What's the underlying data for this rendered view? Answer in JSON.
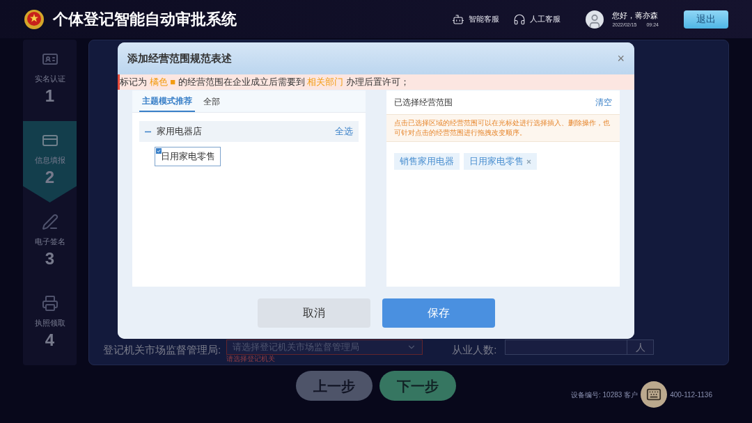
{
  "header": {
    "title": "个体登记智能自动审批系统",
    "services": [
      {
        "kind": "bot",
        "label": "智能客服"
      },
      {
        "kind": "human",
        "label": "人工客服"
      }
    ],
    "user": {
      "greeting": "您好，蒋亦森",
      "date": "2022/02/15",
      "time": "09:24"
    },
    "logout": "退出"
  },
  "steps": [
    {
      "kind": "id",
      "label": "实名认证",
      "number": "1",
      "selected": false
    },
    {
      "kind": "form",
      "label": "信息填报",
      "number": "2",
      "selected": true
    },
    {
      "kind": "sign",
      "label": "电子签名",
      "number": "3",
      "selected": false
    },
    {
      "kind": "license",
      "label": "执照领取",
      "number": "4",
      "selected": false
    }
  ],
  "form": {
    "authority_label": "登记机关市场监督管理局:",
    "authority_placeholder": "请选择登记机关市场监督管理局",
    "authority_error": "请选择登记机关",
    "staff_label": "从业人数:",
    "staff_unit": "人"
  },
  "nav": {
    "prev": "上一步",
    "next": "下一步"
  },
  "footer": {
    "device": "设备编号: 10283 客户",
    "phone": "400-112-1136"
  },
  "dialog": {
    "title": "添加经营范围规范表述",
    "close": "×",
    "notice": "标记为 **橘色 ■** 的经营范围在企业成立后需要到 **相关部门** 办理后置许可；",
    "tabs": [
      {
        "label": "主题模式推荐",
        "selected": true
      },
      {
        "label": "全部",
        "selected": false
      }
    ],
    "groups": [
      {
        "label": "家用电器店",
        "expanded": true,
        "action": "全选",
        "children": [
          {
            "label": "日用家电零售",
            "checked": true
          }
        ]
      }
    ],
    "selected_title": "已选择经营范围",
    "clear": "清空",
    "hint": "点击已选择区域的经营范围可以在光标处进行选择插入、删除操作，也可针对点击的经营范围进行拖拽改变顺序。",
    "tags": [
      {
        "label": "销售家用电器",
        "removable": false
      },
      {
        "label": "日用家电零售",
        "removable": true
      }
    ],
    "cancel": "取消",
    "save": "保存"
  }
}
